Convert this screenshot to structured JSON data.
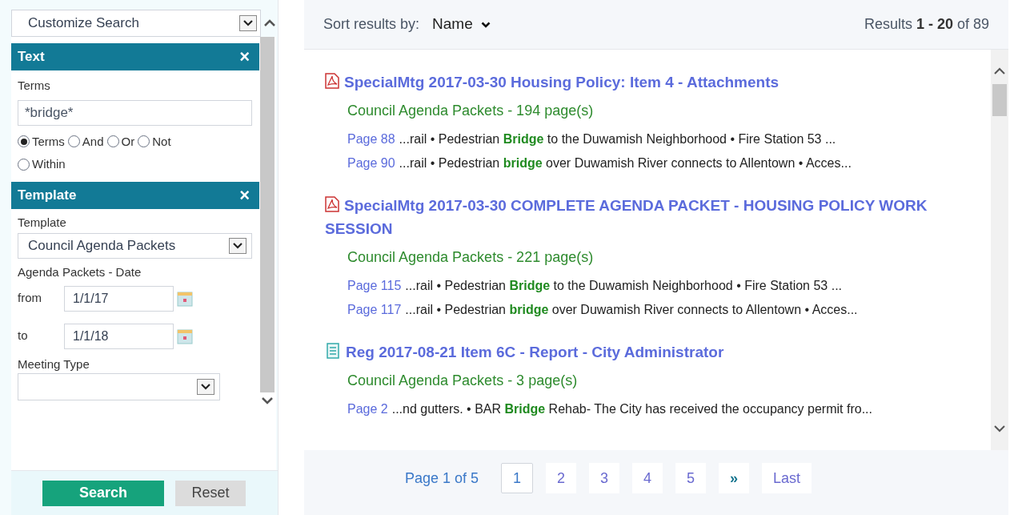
{
  "sidebar": {
    "customize_select": {
      "value": "Customize Search"
    },
    "sections": [
      {
        "title": "Text",
        "close": "×",
        "kind": "text",
        "label": "Terms",
        "value": "*bridge*",
        "options": [
          {
            "label": "Terms",
            "selected": true
          },
          {
            "label": "And",
            "selected": false
          },
          {
            "label": "Or",
            "selected": false
          },
          {
            "label": "Not",
            "selected": false
          },
          {
            "label": "Within",
            "selected": false
          }
        ]
      },
      {
        "title": "Template",
        "close": "×",
        "kind": "template",
        "label": "Template",
        "value": "Council Agenda Packets",
        "date_label": "Agenda Packets - Date",
        "from_label": "from",
        "from_value": "1/1/17",
        "to_label": "to",
        "to_value": "1/1/18",
        "meeting_label": "Meeting Type"
      }
    ],
    "buttons": [
      {
        "label": "Search",
        "kind": "primary"
      },
      {
        "label": "Reset",
        "kind": "secondary"
      }
    ]
  },
  "results": {
    "sort_label": "Sort results by:",
    "sort_value": "Name",
    "count": "Results **1 - 20** of 89",
    "items": [
      {
        "kind": "pdf",
        "title": "SpecialMtg 2017-03-30 Housing Policy: Item 4 - Attachments",
        "source": "Council Agenda Packets - 194 page(s)",
        "hits": [
          {
            "page": "Page 88",
            "text": "...rail • Pedestrian **Bridge** to the Duwamish Neighborhood • Fire Station 53 ..."
          },
          {
            "page": "Page 90",
            "text": "...rail • Pedestrian **bridge** over Duwamish River connects to Allentown • Acces..."
          }
        ]
      },
      {
        "kind": "pdf",
        "title": "SpecialMtg 2017-03-30 COMPLETE AGENDA PACKET - HOUSING POLICY WORK SESSION",
        "source": "Council Agenda Packets - 221 page(s)",
        "hits": [
          {
            "page": "Page 115",
            "text": "...rail • Pedestrian **Bridge** to the Duwamish Neighborhood • Fire Station 53 ..."
          },
          {
            "page": "Page 117",
            "text": "...rail • Pedestrian **bridge** over Duwamish River connects to Allentown • Acces..."
          }
        ]
      },
      {
        "kind": "doc",
        "title": "Reg 2017-08-21 Item 6C - Report - City Administrator",
        "source": "Council Agenda Packets - 3 page(s)",
        "hits": [
          {
            "page": "Page 2",
            "text": "...nd gutters. • BAR **Bridge** Rehab- The City has received the occupancy permit fro..."
          }
        ]
      }
    ]
  },
  "pagination": {
    "label": "Page 1 of 5",
    "pages": [
      {
        "label": "1",
        "selected": true
      },
      {
        "label": "2",
        "selected": false
      },
      {
        "label": "3",
        "selected": false
      },
      {
        "label": "4",
        "selected": false
      },
      {
        "label": "5",
        "selected": false
      }
    ],
    "next": "»",
    "last": "Last"
  }
}
